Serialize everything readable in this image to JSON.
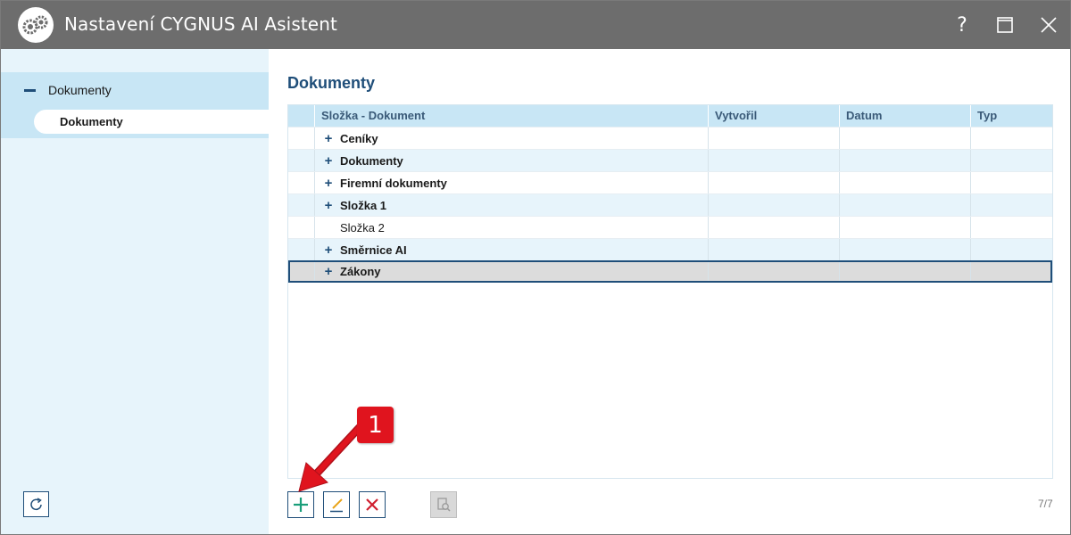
{
  "window": {
    "title": "Nastavení CYGNUS AI Asistent",
    "help_label": "?",
    "title_bg": "#6d6d6d"
  },
  "sidebar": {
    "group_label": "Dokumenty",
    "items": [
      {
        "label": "Dokumenty",
        "selected": true
      }
    ],
    "refresh_icon": "refresh-icon"
  },
  "main": {
    "title": "Dokumenty",
    "columns": [
      "Složka - Dokument",
      "Vytvořil",
      "Datum",
      "Typ"
    ],
    "rows": [
      {
        "name": "Ceníky",
        "expandable": true,
        "bold": true
      },
      {
        "name": "Dokumenty",
        "expandable": true,
        "bold": true
      },
      {
        "name": "Firemní dokumenty",
        "expandable": true,
        "bold": true
      },
      {
        "name": "Složka 1",
        "expandable": true,
        "bold": true
      },
      {
        "name": "Složka 2",
        "expandable": false,
        "bold": false
      },
      {
        "name": "Směrnice AI",
        "expandable": true,
        "bold": true
      },
      {
        "name": "Zákony",
        "expandable": true,
        "bold": true,
        "selected": true
      }
    ],
    "expander_glyph": "+",
    "pager": "7/7"
  },
  "toolbar": {
    "add_icon": "plus-icon",
    "edit_icon": "pencil-icon",
    "delete_icon": "x-icon",
    "preview_icon": "document-search-icon"
  },
  "callout": {
    "number": "1",
    "color": "#e0141e"
  },
  "colors": {
    "accent": "#1f4e79",
    "header_bg": "#c8e6f5",
    "alt_row": "#e7f4fb",
    "add_green": "#1a9e7a",
    "delete_red": "#d01f2f"
  }
}
